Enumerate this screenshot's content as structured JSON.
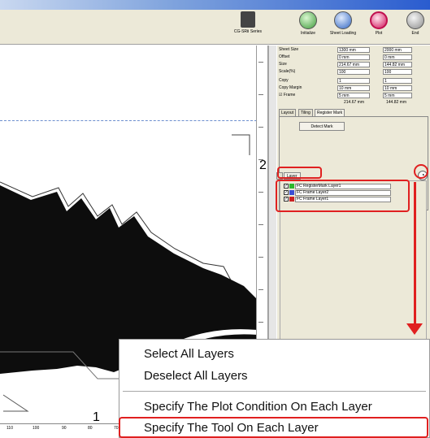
{
  "toolbar": {
    "plotter_label": "CG-SRⅡ Series",
    "initialize_label": "Initialize",
    "sheet_loading_label": "Sheet Loading",
    "plot_label": "Plot",
    "end_label": "End"
  },
  "properties": {
    "sheet_size": {
      "label": "Sheet Size",
      "w": "1300 mm",
      "h": "2000 mm"
    },
    "offset": {
      "label": "Offset",
      "w": "0 mm",
      "h": "0 mm"
    },
    "size": {
      "label": "Size",
      "w": "214.67 mm",
      "h": "144.82 mm"
    },
    "scale": {
      "label": "Scale(%)",
      "w": "100",
      "h": "100"
    },
    "copy": {
      "label": "Copy",
      "w": "1",
      "h": "1"
    },
    "copy_margin": {
      "label": "Copy Margin",
      "w": "10 mm",
      "h": "10 mm"
    },
    "frame": {
      "label": "Frame",
      "w": "5 mm",
      "h": "5 mm"
    },
    "total_w": "214.67 mm",
    "total_h": "144.82 mm"
  },
  "tabs": {
    "layout": "Layout",
    "tiling": "Tiling",
    "register_mark": "Register Mark"
  },
  "detect_mark_label": "Detect Mark",
  "layer_tab_label": "Layer",
  "layers": [
    {
      "name": "FC RegisterMark Layer1",
      "color": "#2db82d"
    },
    {
      "name": "FC Frame Layer2",
      "color": "#3a4fd6"
    },
    {
      "name": "FC Frame Layer1",
      "color": "#cc2222"
    }
  ],
  "context_menu": {
    "items": [
      "Select All Layers",
      "Deselect All Layers",
      "Specify The Plot Condition On Each Layer",
      "Specify The Tool On Each Layer"
    ]
  },
  "annotations": {
    "label_1": "1",
    "label_2": "2"
  },
  "ruler": {
    "h_labels": [
      "110",
      "100",
      "90",
      "80",
      "70"
    ]
  },
  "colors": {
    "annotation_red": "#e02020"
  }
}
